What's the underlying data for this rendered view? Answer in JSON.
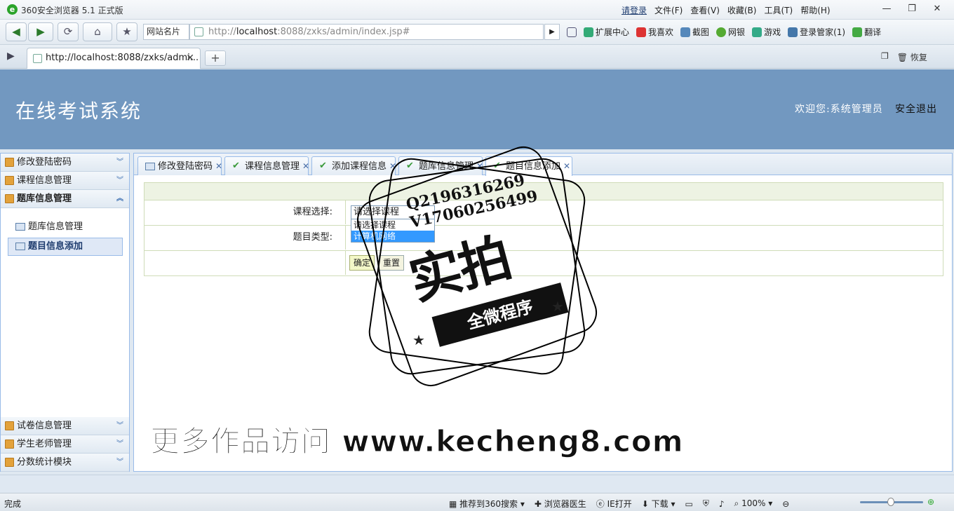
{
  "browser": {
    "title": "360安全浏览器 5.1 正式版",
    "login": "请登录",
    "menu": [
      "文件(F)",
      "查看(V)",
      "收藏(B)",
      "工具(T)",
      "帮助(H)"
    ],
    "site_card": "网站名片",
    "url_prefix": "http://",
    "url_host": "localhost",
    "url_rest": ":8088/zxks/admin/index.jsp#",
    "tools": [
      "扩展中心",
      "我喜欢",
      "截图",
      "网银",
      "游戏",
      "登录管家(1)",
      "翻译"
    ],
    "tab_title": "http://localhost:8088/zxks/admi...",
    "restore": "恢复"
  },
  "header": {
    "title": "在线考试系统",
    "welcome": "欢迎您:系统管理员",
    "logout": "安全退出"
  },
  "sidebar": {
    "groups": [
      "修改登陆密码",
      "课程信息管理",
      "题库信息管理",
      "试卷信息管理",
      "学生老师管理",
      "分数统计模块"
    ],
    "items": [
      "题库信息管理",
      "题目信息添加"
    ]
  },
  "tabs": [
    "修改登陆密码",
    "课程信息管理",
    "添加课程信息",
    "题库信息管理",
    "题目信息添加"
  ],
  "form": {
    "course_label": "课程选择:",
    "course_value": "请选择课程",
    "dropdown_options": [
      "请选择课程",
      "计算机网络"
    ],
    "type_label": "题目类型:",
    "ok": "确定",
    "reset": "重置"
  },
  "watermark": {
    "qq": "Q2196316269",
    "wechat": "V17060256499",
    "big": "实拍",
    "ribbon": "全微程序",
    "bottom": "更多作品访问 www.kecheng8.com"
  },
  "status": {
    "done": "完成",
    "tools": [
      "推荐到360搜索",
      "浏览器医生",
      "IE打开",
      "下载"
    ],
    "zoom": "100%"
  }
}
